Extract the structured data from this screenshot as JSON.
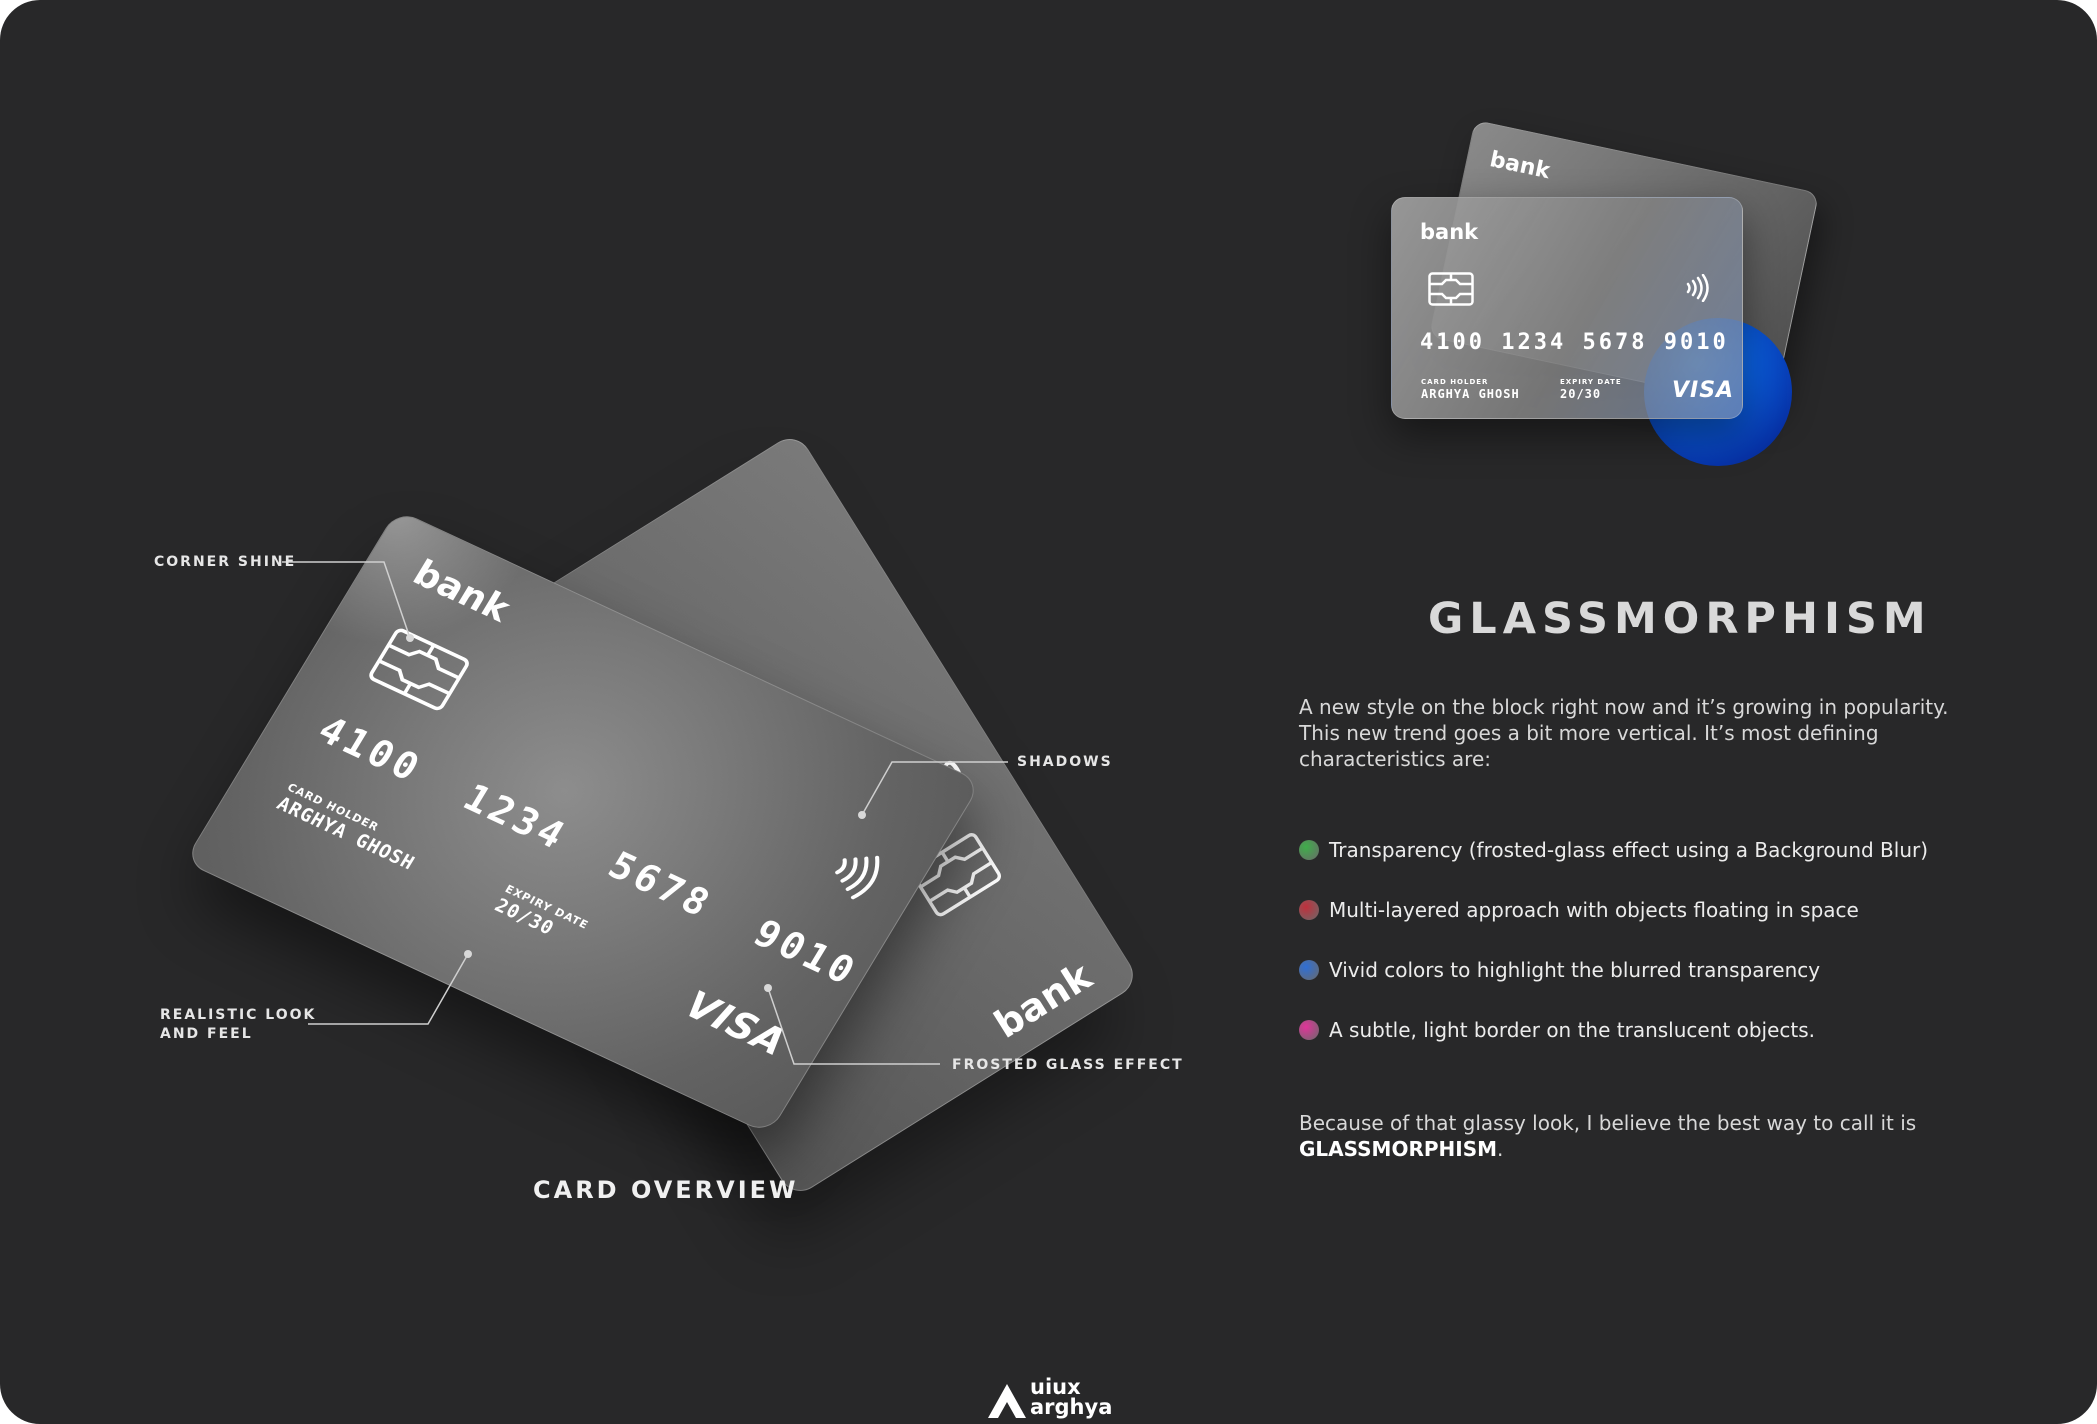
{
  "card": {
    "bank_label": "bank",
    "number_groups": [
      "4100",
      "1234",
      "5678",
      "9010"
    ],
    "number_partial": "4100",
    "holder_label": "CARD HOLDER",
    "holder_name": "ARGHYA GHOSH",
    "expiry_label": "EXPIRY DATE",
    "expiry_value": "20/30",
    "brand": "VISA"
  },
  "annotations": {
    "corner_shine": "CORNER SHINE",
    "shadows": "SHADOWS",
    "realistic_line1": "REALISTIC LOOK",
    "realistic_line2": "AND FEEL",
    "frosted_glass": "FROSTED GLASS EFFECT"
  },
  "overview_title": "CARD OVERVIEW",
  "title": "GLASSMORPHISM",
  "intro": "A new style on the block right now and it’s growing in popularity. This new trend goes a bit more vertical. It’s most defining characteristics are:",
  "features": [
    {
      "text": "Transparency (frosted-glass effect using a Background Blur)",
      "color": "#3fae4a"
    },
    {
      "text": "Multi-layered approach with objects floating in space",
      "color": "#c0303c"
    },
    {
      "text": "Vivid colors to highlight the blurred transparency",
      "color": "#2f6fd6"
    },
    {
      "text": "A subtle, light border on the translucent objects.",
      "color": "#e0349a"
    }
  ],
  "outro_prefix": "Because of that glassy look, I believe the best way to call it is",
  "outro_bold": "GLASSMORPHISM",
  "outro_suffix": ".",
  "logo": {
    "line1": "uiux",
    "line2": "arghya"
  },
  "colors": {
    "background": "#282829",
    "accent_blue": "#0a5fe0"
  }
}
